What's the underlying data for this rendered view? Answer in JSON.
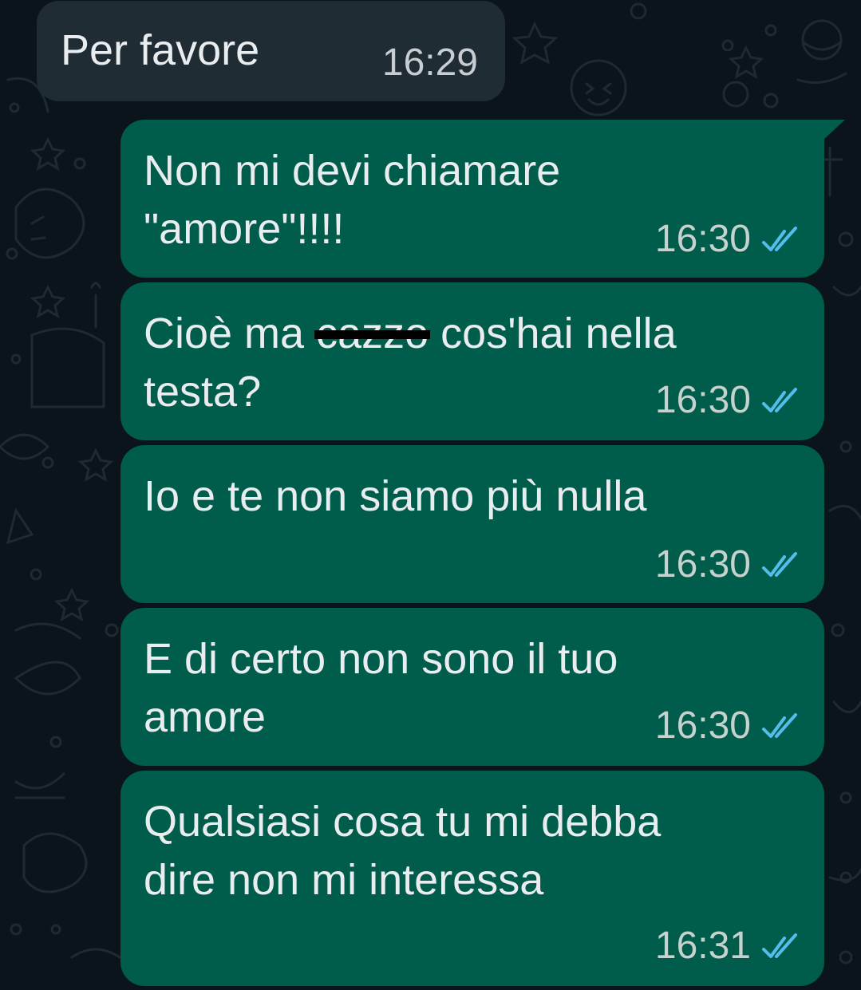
{
  "colors": {
    "background": "#0b141a",
    "incoming_bubble": "#202c33",
    "outgoing_bubble": "#005c4b",
    "text": "#e9edef",
    "read_ticks": "#53bdeb"
  },
  "incoming": {
    "text": "Per favore",
    "time": "16:29"
  },
  "outgoing": [
    {
      "lines": [
        "Non mi devi chiamare",
        "\"amore\"!!!!"
      ],
      "time": "16:30",
      "status_icon": "double-check-read-icon"
    },
    {
      "line1_before": "Cioè ma ",
      "line1_censored": "cazzo",
      "line1_after": " cos'hai nella",
      "line2": "testa?",
      "time": "16:30",
      "status_icon": "double-check-read-icon"
    },
    {
      "lines": [
        "Io e te non siamo più nulla"
      ],
      "time": "16:30",
      "status_icon": "double-check-read-icon"
    },
    {
      "lines": [
        "E di certo non sono il tuo",
        "amore"
      ],
      "time": "16:30",
      "status_icon": "double-check-read-icon"
    },
    {
      "lines": [
        "Qualsiasi cosa tu mi debba",
        "dire non mi interessa"
      ],
      "time": "16:31",
      "status_icon": "double-check-read-icon"
    }
  ]
}
